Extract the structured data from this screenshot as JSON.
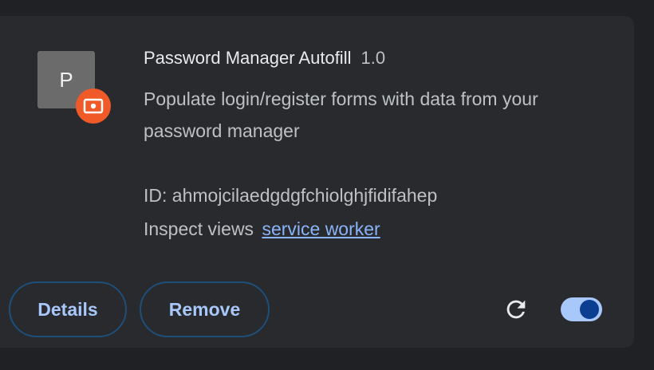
{
  "extension": {
    "icon_letter": "P",
    "name": "Password Manager Autofill",
    "version": "1.0",
    "description": "Populate login/register forms with data from your password manager",
    "id_text": "ID: ahmojcilaedgdgfchiolghjfidifahep",
    "inspect_label": "Inspect views",
    "inspect_link": "service worker",
    "enabled": true
  },
  "actions": {
    "details_label": "Details",
    "remove_label": "Remove"
  },
  "icons": {
    "badge": "unpacked-extension-badge-icon",
    "reload": "reload-icon"
  },
  "colors": {
    "badge": "#f05a28",
    "accent": "#a8c7fa",
    "link": "#8ab4f8",
    "toggle_knob": "#0b3d91"
  }
}
